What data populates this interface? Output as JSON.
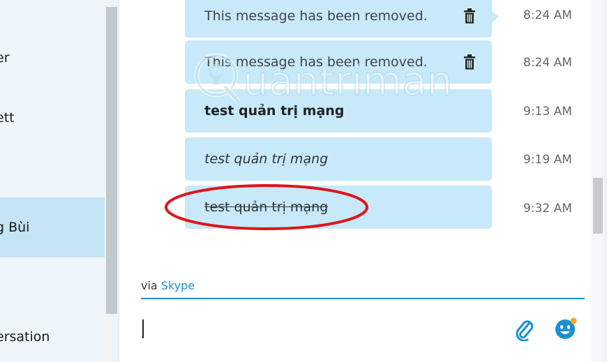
{
  "sidebar": {
    "contacts": [
      {
        "label": "er"
      },
      {
        "label": "ett"
      },
      {
        "label": ""
      },
      {
        "label": "g Bùi"
      },
      {
        "label": ""
      },
      {
        "label": "ersation"
      }
    ],
    "selected_index": 3
  },
  "messages": [
    {
      "text": "This message has been removed.",
      "time": "8:24 AM",
      "style": "removed",
      "icon": "trash-icon"
    },
    {
      "text": "This message has been removed.",
      "time": "8:24 AM",
      "style": "removed",
      "icon": "trash-icon"
    },
    {
      "text": "test quản trị mạng",
      "time": "9:13 AM",
      "style": "bold"
    },
    {
      "text": "test quản trị mạng",
      "time": "9:19 AM",
      "style": "italic"
    },
    {
      "text": "test quản trị mạng",
      "time": "9:32 AM",
      "style": "strikethrough"
    }
  ],
  "composer": {
    "via_prefix": "via",
    "via_brand": "Skype",
    "attach_icon": "paperclip-icon",
    "emoji_icon": "emoticon-icon",
    "accent_color": "#1b8fd0"
  },
  "watermark": {
    "text": "uantrimang"
  },
  "colors": {
    "bubble": "#c7e9fa",
    "selected_contact": "#c5e5f6",
    "highlight_ellipse": "#e0141c"
  }
}
